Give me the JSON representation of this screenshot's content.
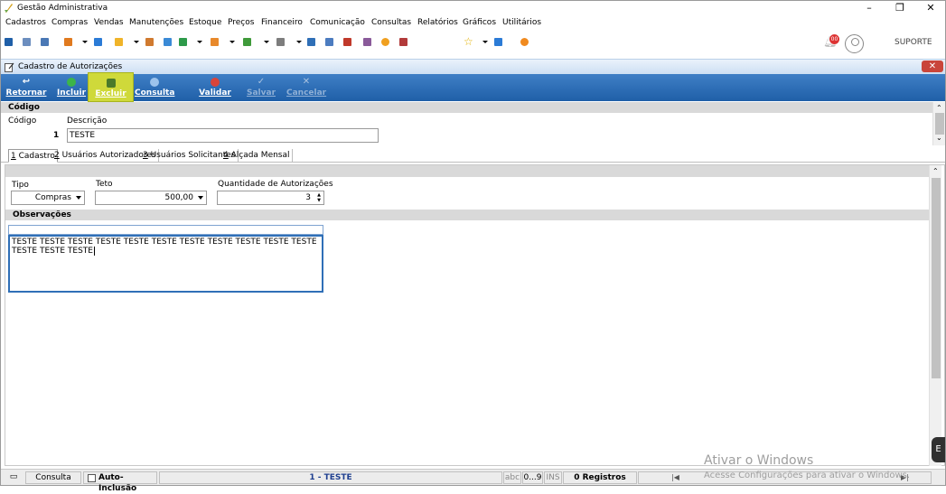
{
  "window": {
    "title": "Gestão Administrativa",
    "controls": [
      "–",
      "❐",
      "✕"
    ]
  },
  "menu": [
    "Cadastros",
    "Compras",
    "Vendas",
    "Manutenções",
    "Estoque",
    "Preços",
    "Financeiro",
    "Comunicação",
    "Consultas",
    "Relatórios",
    "Gráficos",
    "Utilitários"
  ],
  "toolbar": {
    "notification_count": "00",
    "user": "SUPORTE"
  },
  "form": {
    "title": "Cadastro de Autorizações",
    "close": "✕",
    "actions": [
      {
        "label": "Retornar",
        "icon": "return-icon",
        "state": "enabled"
      },
      {
        "label": "Incluir",
        "icon": "add-icon",
        "state": "enabled"
      },
      {
        "label": "Excluir",
        "icon": "delete-icon",
        "state": "selected"
      },
      {
        "label": "Consulta",
        "icon": "search-icon",
        "state": "enabled"
      },
      {
        "label": "Validar",
        "icon": "validate-icon",
        "state": "enabled"
      },
      {
        "label": "Salvar",
        "icon": "save-icon",
        "state": "disabled"
      },
      {
        "label": "Cancelar",
        "icon": "cancel-icon",
        "state": "disabled"
      }
    ],
    "code_section": "Código",
    "code_label": "Código",
    "code_value": "1",
    "description_label": "Descrição",
    "description_value": "TESTE",
    "tabs": [
      {
        "key": "1",
        "label": " Cadastro"
      },
      {
        "key": "2",
        "label": " Usuários Autorizadores"
      },
      {
        "key": "3",
        "label": " Usuários Solicitantes"
      },
      {
        "key": "4",
        "label": " Alçada Mensal"
      }
    ],
    "tipo_label": "Tipo",
    "tipo_value": "Compras",
    "teto_label": "Teto",
    "teto_value": "500,00",
    "qtd_label": "Quantidade de Autorizações",
    "qtd_value": "3",
    "obs_section": "Observações",
    "obs_text": "TESTE TESTE TESTE TESTE TESTE TESTE TESTE TESTE TESTE TESTE TESTE TESTE TESTE TESTE"
  },
  "status": {
    "mode": "Consulta",
    "auto_inclusao": "Auto-Inclusão",
    "record": "1 - TESTE",
    "abc": "abc",
    "range": "0...9",
    "ins": "INS",
    "registros": "0 Registros",
    "nav_first": "|◀",
    "nav_last": "▶|"
  },
  "watermark": {
    "line1": "Ativar o Windows",
    "line2": "Acesse Configurações para ativar o Windows."
  },
  "colors": {
    "actionbar": "#2a6ab5",
    "selected": "#cfd93a",
    "badge": "#d33333"
  }
}
